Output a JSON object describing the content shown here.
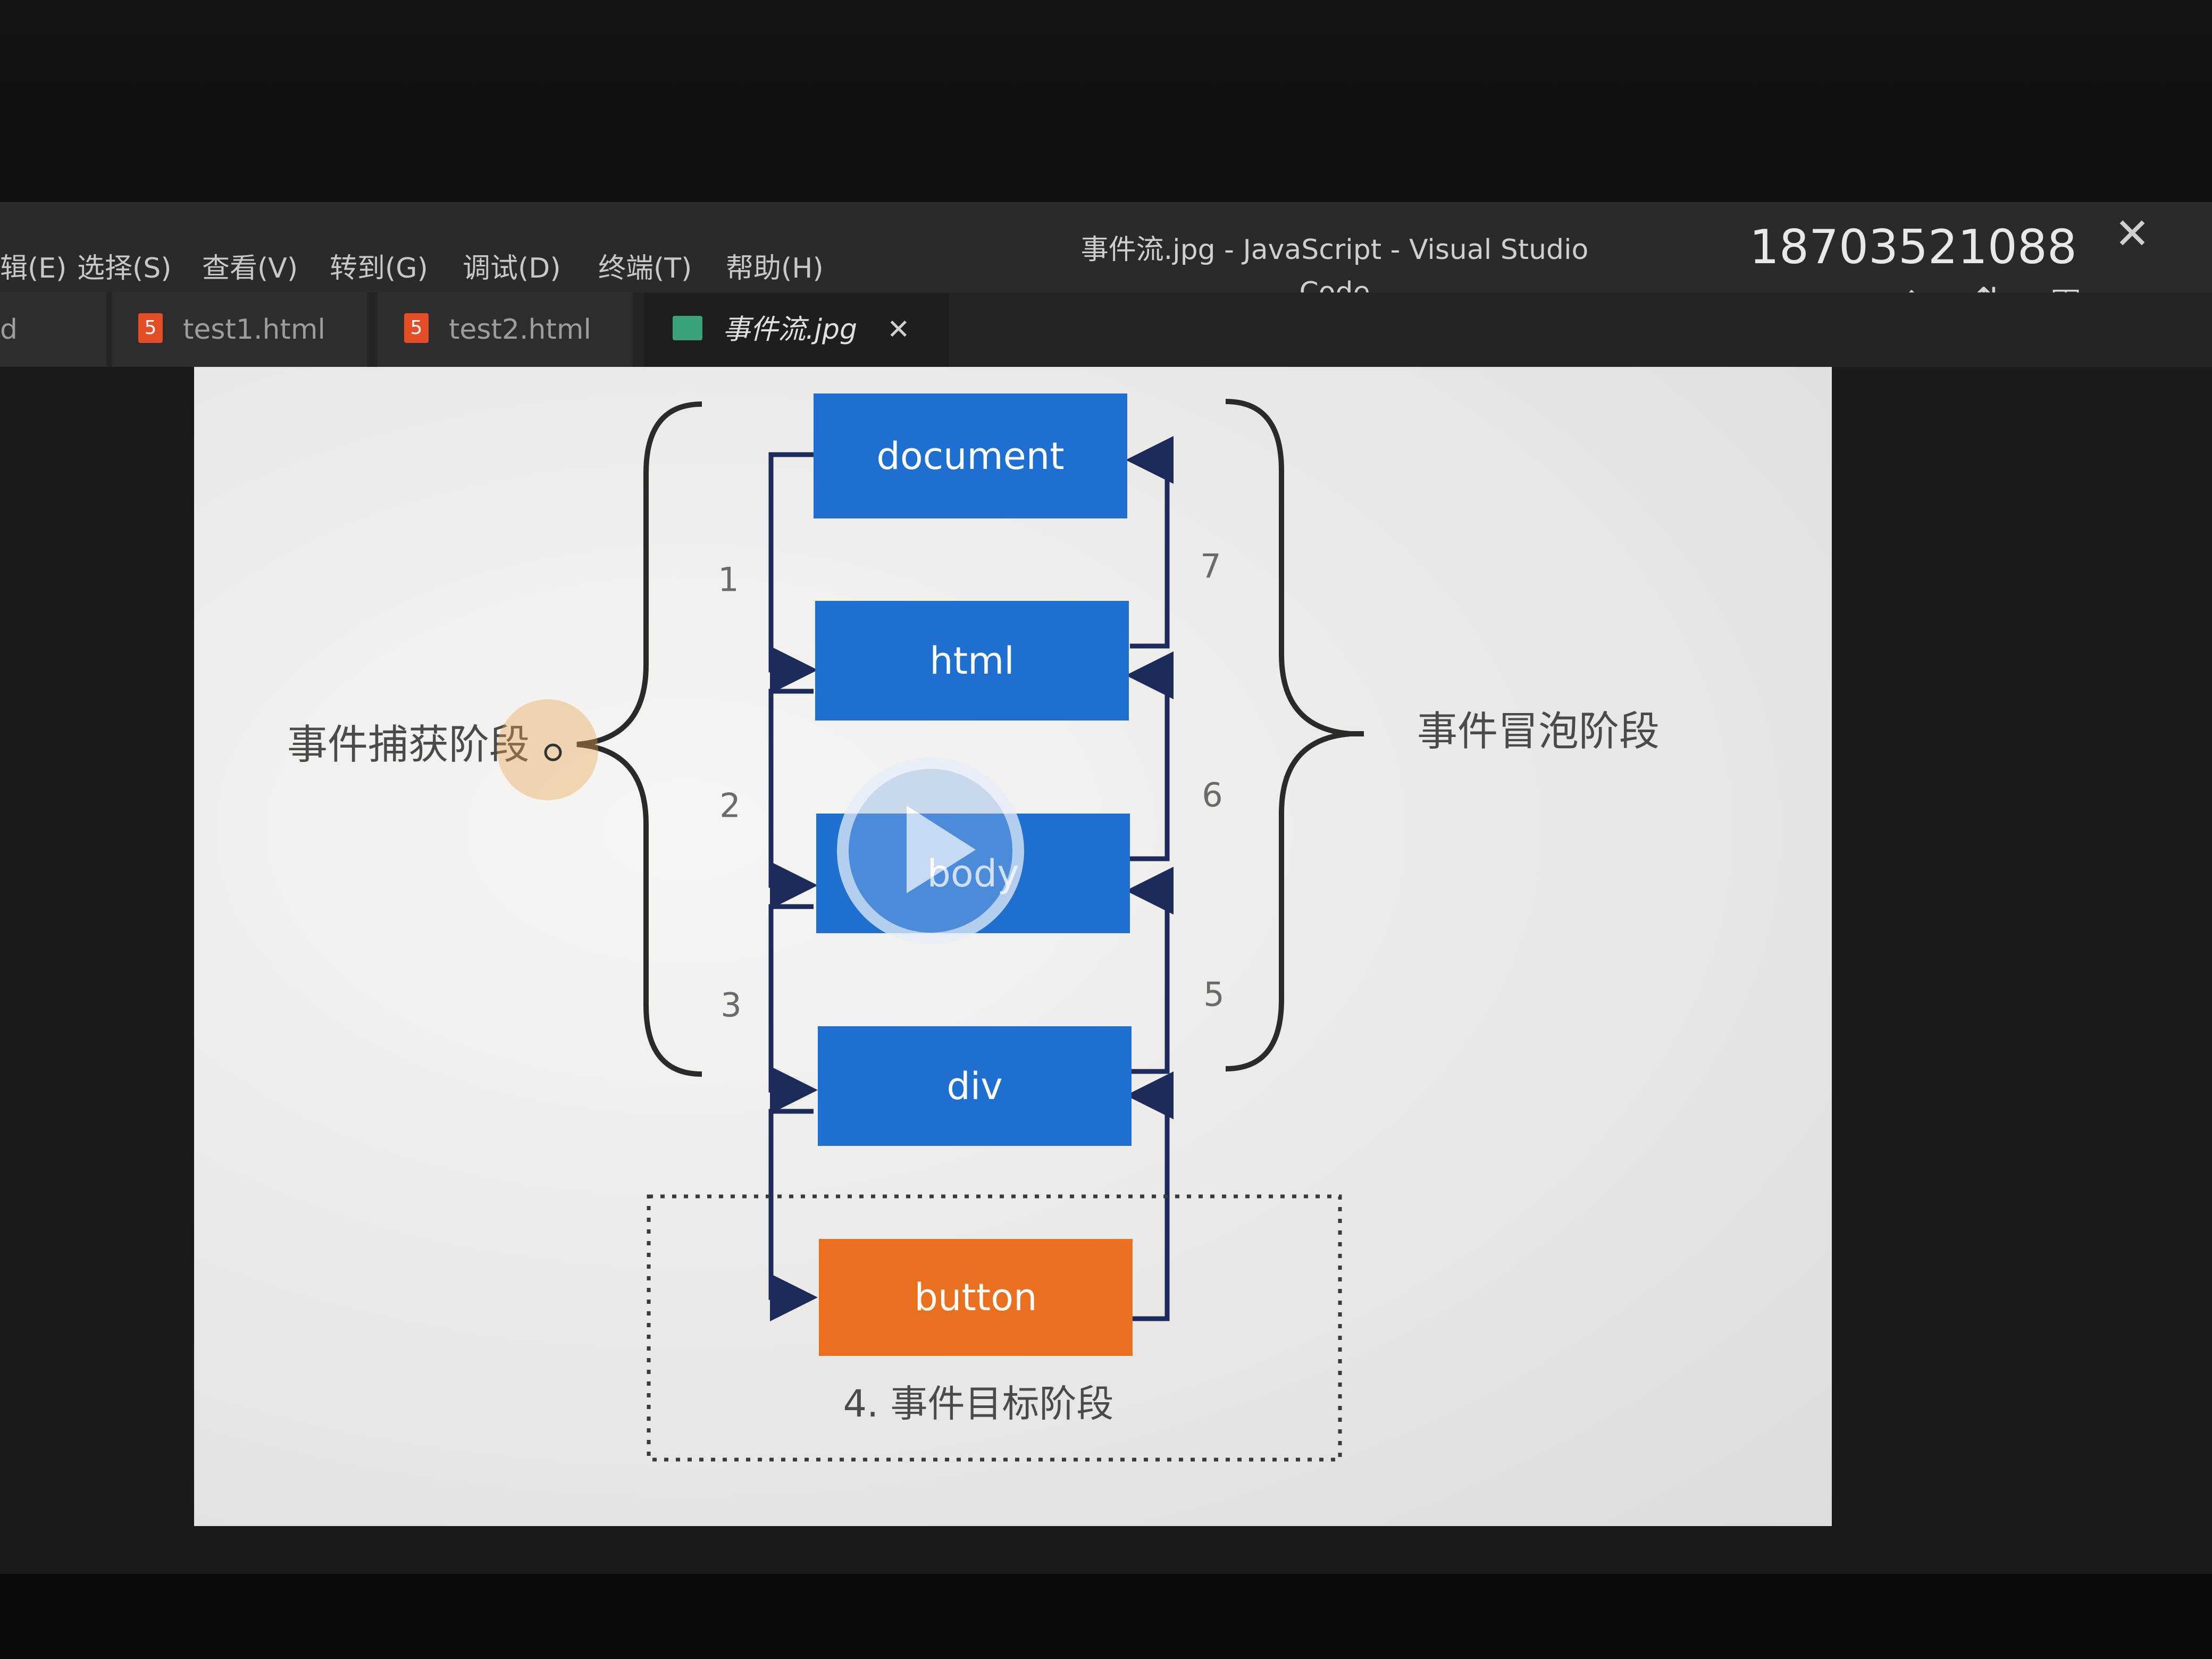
{
  "window": {
    "title": "事件流.jpg - JavaScript - Visual Studio Code",
    "overlay_number": "18703521088",
    "close_glyph": "✕"
  },
  "menu": [
    {
      "label": "辑(E)"
    },
    {
      "label": "选择(S)"
    },
    {
      "label": "查看(V)"
    },
    {
      "label": "转到(G)"
    },
    {
      "label": "调试(D)"
    },
    {
      "label": "终端(T)"
    },
    {
      "label": "帮助(H)"
    }
  ],
  "tabs": [
    {
      "label": "d",
      "icon": "none"
    },
    {
      "label": "test1.html",
      "icon": "html5-icon"
    },
    {
      "label": "test2.html",
      "icon": "html5-icon"
    },
    {
      "label": "事件流.jpg",
      "icon": "image-icon",
      "active": true,
      "close": "✕"
    }
  ],
  "toolbar_icons": [
    "git-diamond-icon",
    "compare-changes-icon",
    "split-editor-icon",
    "more-actions-icon"
  ],
  "diagram": {
    "nodes": [
      {
        "label": "document",
        "color": "#1e6fd0"
      },
      {
        "label": "html",
        "color": "#1e6fd0"
      },
      {
        "label": "body",
        "color": "#1e6fd0"
      },
      {
        "label": "div",
        "color": "#1e6fd0"
      },
      {
        "label": "button",
        "color": "#e8701f"
      }
    ],
    "capture_steps": [
      "1",
      "2",
      "3"
    ],
    "bubble_steps": [
      "7",
      "6",
      "5"
    ],
    "capture_phase": "事件捕获阶段",
    "bubble_phase": "事件冒泡阶段",
    "target_phase": "4. 事件目标阶段",
    "arrow_color": "#1c2b5a"
  },
  "overlays": [
    "play-button-icon",
    "cursor-highlight"
  ]
}
